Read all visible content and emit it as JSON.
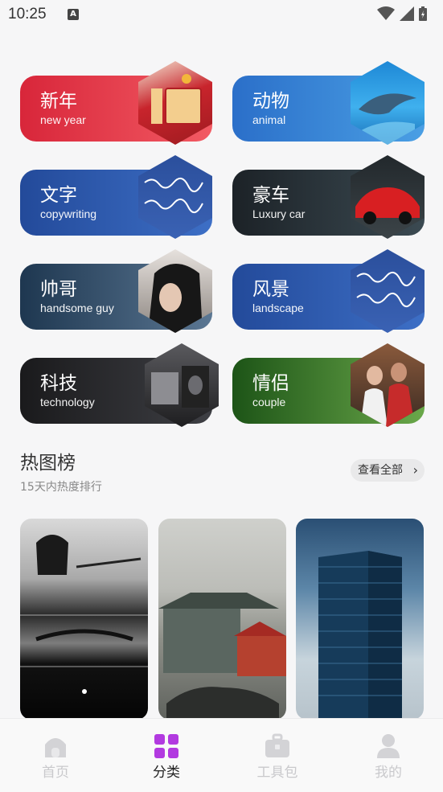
{
  "status": {
    "time": "10:25",
    "indicator": "A"
  },
  "categories": [
    {
      "title": "新年",
      "subtitle": "new year",
      "color_from": "#d8263a",
      "color_to": "#f25a63"
    },
    {
      "title": "动物",
      "subtitle": "animal",
      "color_from": "#2b6fc9",
      "color_to": "#4a9fe4"
    },
    {
      "title": "文字",
      "subtitle": "copywriting",
      "color_from": "#234a9a",
      "color_to": "#3d6fc6"
    },
    {
      "title": "豪车",
      "subtitle": "Luxury car",
      "color_from": "#1c2227",
      "color_to": "#3b4a52"
    },
    {
      "title": "帅哥",
      "subtitle": "handsome guy",
      "color_from": "#1e3750",
      "color_to": "#5b7793"
    },
    {
      "title": "风景",
      "subtitle": "landscape",
      "color_from": "#234a9a",
      "color_to": "#3d6fc6"
    },
    {
      "title": "科技",
      "subtitle": "technology",
      "color_from": "#1a1a1c",
      "color_to": "#3e3f44"
    },
    {
      "title": "情侣",
      "subtitle": "couple",
      "color_from": "#1d5417",
      "color_to": "#6aa84a"
    }
  ],
  "hot": {
    "title": "热图榜",
    "subtitle": "15天内热度排行",
    "view_all": "查看全部"
  },
  "tabs": [
    {
      "label": "首页",
      "icon": "home-icon",
      "active": false
    },
    {
      "label": "分类",
      "icon": "grid-icon",
      "active": true
    },
    {
      "label": "工具包",
      "icon": "toolbox-icon",
      "active": false
    },
    {
      "label": "我的",
      "icon": "user-icon",
      "active": false
    }
  ],
  "colors": {
    "accent": "#a833d6",
    "inactive": "#c9c9cc",
    "background": "#f6f6f7"
  }
}
